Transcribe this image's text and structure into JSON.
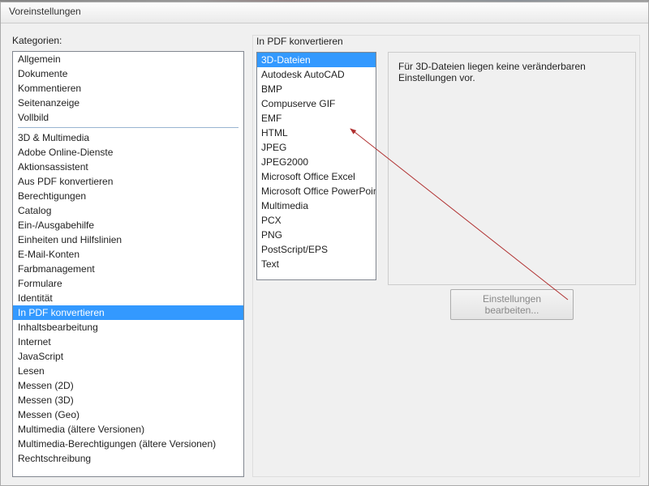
{
  "window": {
    "title": "Voreinstellungen"
  },
  "leftPanel": {
    "label": "Kategorien:",
    "group1": [
      "Allgemein",
      "Dokumente",
      "Kommentieren",
      "Seitenanzeige",
      "Vollbild"
    ],
    "group2": [
      "3D & Multimedia",
      "Adobe Online-Dienste",
      "Aktionsassistent",
      "Aus PDF konvertieren",
      "Berechtigungen",
      "Catalog",
      "Ein-/Ausgabehilfe",
      "Einheiten und Hilfslinien",
      "E-Mail-Konten",
      "Farbmanagement",
      "Formulare",
      "Identität",
      "In PDF konvertieren",
      "Inhaltsbearbeitung",
      "Internet",
      "JavaScript",
      "Lesen",
      "Messen (2D)",
      "Messen (3D)",
      "Messen (Geo)",
      "Multimedia (ältere Versionen)",
      "Multimedia-Berechtigungen (ältere Versionen)",
      "Rechtschreibung"
    ],
    "selected": "In PDF konvertieren"
  },
  "rightPanel": {
    "header": "In PDF konvertieren",
    "formats": [
      "3D-Dateien",
      "Autodesk AutoCAD",
      "BMP",
      "Compuserve GIF",
      "EMF",
      "HTML",
      "JPEG",
      "JPEG2000",
      "Microsoft Office Excel",
      "Microsoft Office PowerPoint",
      "Multimedia",
      "PCX",
      "PNG",
      "PostScript/EPS",
      "Text"
    ],
    "selectedFormat": "3D-Dateien",
    "settingsDescription": "Für 3D-Dateien liegen keine veränderbaren Einstellungen vor.",
    "editButtonLabel": "Einstellungen bearbeiten..."
  }
}
